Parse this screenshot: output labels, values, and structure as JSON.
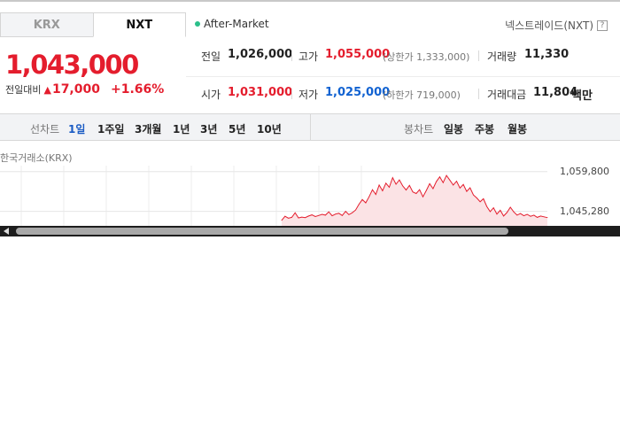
{
  "tabs": [
    {
      "label": "KRX",
      "active": false
    },
    {
      "label": "NXT",
      "active": true
    }
  ],
  "session": {
    "label": "After-Market",
    "dot_color": "#2bbf8a"
  },
  "exchange": {
    "label": "넥스트레이드(NXT)",
    "help": "?"
  },
  "price": {
    "current": "1,043,000",
    "change_label": "전일대비",
    "change_icon": "triangle-up-icon",
    "change_amount": "17,000",
    "change_percent": "+1.66%",
    "up_color": "#e41d2d"
  },
  "stats": {
    "prev_close": {
      "label": "전일",
      "value": "1,026,000"
    },
    "high": {
      "label": "고가",
      "value": "1,055,000",
      "sub": "(상한가 1,333,000)"
    },
    "volume": {
      "label": "거래량",
      "value": "11,330"
    },
    "open": {
      "label": "시가",
      "value": "1,031,000"
    },
    "low": {
      "label": "저가",
      "value": "1,025,000",
      "sub": "(하한가 719,000)",
      "color": "#1162d1"
    },
    "amount": {
      "label": "거래대금",
      "value": "11,804",
      "unit": "백만"
    }
  },
  "period_bar": {
    "line_chart_label": "선차트",
    "periods": [
      "1일",
      "1주일",
      "3개월",
      "1년",
      "3년",
      "5년",
      "10년"
    ],
    "selected": "1일",
    "candle_chart_label": "봉차트",
    "candle_periods": [
      "일봉",
      "주봉",
      "월봉"
    ]
  },
  "chart_data": {
    "type": "line",
    "source_label": "한국거래소(KRX)",
    "y_ticks": [
      "1,059,800",
      "1,045,280"
    ],
    "y_tick_values": [
      1059800,
      1045280
    ],
    "ylim": [
      1040000,
      1062000
    ],
    "series": [
      {
        "values": [
          1042000,
          1043500,
          1042800,
          1043100,
          1044800,
          1042900,
          1043200,
          1043000,
          1043600,
          1044000,
          1043400,
          1043800,
          1044200,
          1043900,
          1045100,
          1043700,
          1044300,
          1044600,
          1043800,
          1045300,
          1044100,
          1044800,
          1045800,
          1047900,
          1049600,
          1048400,
          1050600,
          1053200,
          1051500,
          1054900,
          1052800,
          1055600,
          1054100,
          1057600,
          1055200,
          1056800,
          1054600,
          1053100,
          1054800,
          1052400,
          1051800,
          1053200,
          1050600,
          1052900,
          1055400,
          1053600,
          1056200,
          1057900,
          1055800,
          1058400,
          1056700,
          1054900,
          1056300,
          1053800,
          1055100,
          1052600,
          1053900,
          1051300,
          1050200,
          1048800,
          1049900,
          1047100,
          1045200,
          1046600,
          1044300,
          1045700,
          1043600,
          1044900,
          1046800,
          1045100,
          1043900,
          1044500,
          1043700,
          1044200,
          1043500,
          1043900,
          1043100,
          1043600,
          1043300,
          1043000
        ]
      }
    ],
    "line_color": "#e41d2d",
    "fill_color": "#fbe3e5",
    "grid": true
  },
  "scrollbar": {
    "left_arrow": "scroll-left-arrow-icon"
  }
}
